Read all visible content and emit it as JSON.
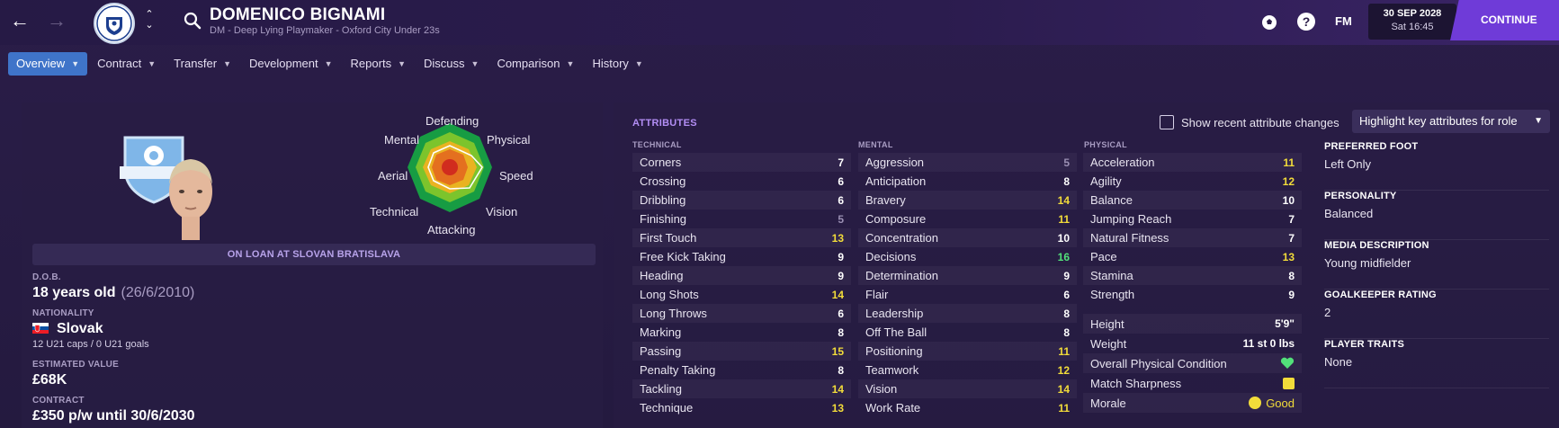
{
  "header": {
    "player_name": "DOMENICO BIGNAMI",
    "player_subtitle": "DM - Deep Lying Playmaker - Oxford City Under 23s",
    "fm_label": "FM",
    "date": "30 SEP 2028",
    "time": "Sat 16:45",
    "continue_label": "CONTINUE"
  },
  "tabs": [
    {
      "label": "Overview",
      "active": true
    },
    {
      "label": "Contract"
    },
    {
      "label": "Transfer"
    },
    {
      "label": "Development"
    },
    {
      "label": "Reports"
    },
    {
      "label": "Discuss"
    },
    {
      "label": "Comparison"
    },
    {
      "label": "History"
    }
  ],
  "polar_labels": {
    "defending": "Defending",
    "physical": "Physical",
    "speed": "Speed",
    "vision": "Vision",
    "attacking": "Attacking",
    "technical": "Technical",
    "aerial": "Aerial",
    "mental": "Mental"
  },
  "profile": {
    "loan_status": "ON LOAN AT SLOVAN BRATISLAVA",
    "dob_label": "D.O.B.",
    "age": "18 years old",
    "dob": "(26/6/2010)",
    "nationality_label": "NATIONALITY",
    "nationality": "Slovak",
    "caps": "12 U21 caps / 0 U21 goals",
    "value_label": "ESTIMATED VALUE",
    "value": "£68K",
    "contract_label": "CONTRACT",
    "contract": "£350 p/w until 30/6/2030"
  },
  "attributes": {
    "title": "ATTRIBUTES",
    "recent_changes_label": "Show recent attribute changes",
    "highlight_label": "Highlight key attributes for role",
    "technical_head": "TECHNICAL",
    "mental_head": "MENTAL",
    "physical_head": "PHYSICAL",
    "technical": [
      {
        "name": "Corners",
        "value": "7",
        "tone": "white"
      },
      {
        "name": "Crossing",
        "value": "6",
        "tone": "white"
      },
      {
        "name": "Dribbling",
        "value": "6",
        "tone": "white"
      },
      {
        "name": "Finishing",
        "value": "5",
        "tone": "dim"
      },
      {
        "name": "First Touch",
        "value": "13",
        "tone": "yellow"
      },
      {
        "name": "Free Kick Taking",
        "value": "9",
        "tone": "white"
      },
      {
        "name": "Heading",
        "value": "9",
        "tone": "white"
      },
      {
        "name": "Long Shots",
        "value": "14",
        "tone": "yellow"
      },
      {
        "name": "Long Throws",
        "value": "6",
        "tone": "white"
      },
      {
        "name": "Marking",
        "value": "8",
        "tone": "white"
      },
      {
        "name": "Passing",
        "value": "15",
        "tone": "yellow"
      },
      {
        "name": "Penalty Taking",
        "value": "8",
        "tone": "white"
      },
      {
        "name": "Tackling",
        "value": "14",
        "tone": "yellow"
      },
      {
        "name": "Technique",
        "value": "13",
        "tone": "yellow"
      }
    ],
    "mental": [
      {
        "name": "Aggression",
        "value": "5",
        "tone": "dim"
      },
      {
        "name": "Anticipation",
        "value": "8",
        "tone": "white"
      },
      {
        "name": "Bravery",
        "value": "14",
        "tone": "yellow"
      },
      {
        "name": "Composure",
        "value": "11",
        "tone": "yellow"
      },
      {
        "name": "Concentration",
        "value": "10",
        "tone": "white"
      },
      {
        "name": "Decisions",
        "value": "16",
        "tone": "green"
      },
      {
        "name": "Determination",
        "value": "9",
        "tone": "white"
      },
      {
        "name": "Flair",
        "value": "6",
        "tone": "white"
      },
      {
        "name": "Leadership",
        "value": "8",
        "tone": "white"
      },
      {
        "name": "Off The Ball",
        "value": "8",
        "tone": "white"
      },
      {
        "name": "Positioning",
        "value": "11",
        "tone": "yellow"
      },
      {
        "name": "Teamwork",
        "value": "12",
        "tone": "yellow"
      },
      {
        "name": "Vision",
        "value": "14",
        "tone": "yellow"
      },
      {
        "name": "Work Rate",
        "value": "11",
        "tone": "yellow"
      }
    ],
    "physical": [
      {
        "name": "Acceleration",
        "value": "11",
        "tone": "yellow"
      },
      {
        "name": "Agility",
        "value": "12",
        "tone": "yellow"
      },
      {
        "name": "Balance",
        "value": "10",
        "tone": "white"
      },
      {
        "name": "Jumping Reach",
        "value": "7",
        "tone": "white"
      },
      {
        "name": "Natural Fitness",
        "value": "7",
        "tone": "white"
      },
      {
        "name": "Pace",
        "value": "13",
        "tone": "yellow"
      },
      {
        "name": "Stamina",
        "value": "8",
        "tone": "white"
      },
      {
        "name": "Strength",
        "value": "9",
        "tone": "white"
      }
    ],
    "extra": {
      "height_label": "Height",
      "height": "5'9\"",
      "weight_label": "Weight",
      "weight": "11 st 0 lbs",
      "condition_label": "Overall Physical Condition",
      "sharpness_label": "Match Sharpness",
      "morale_label": "Morale",
      "morale": "Good"
    }
  },
  "side_info": [
    {
      "label": "PREFERRED FOOT",
      "value": "Left Only"
    },
    {
      "label": "PERSONALITY",
      "value": "Balanced"
    },
    {
      "label": "MEDIA DESCRIPTION",
      "value": "Young midfielder"
    },
    {
      "label": "GOALKEEPER RATING",
      "value": "2"
    },
    {
      "label": "PLAYER TRAITS",
      "value": "None"
    }
  ],
  "colors": {
    "accent": "#6f3bd8",
    "tab_active": "#3f74c9",
    "attr_yellow": "#f2dc3a",
    "attr_green": "#52e07a",
    "attr_title": "#b38ef5"
  }
}
